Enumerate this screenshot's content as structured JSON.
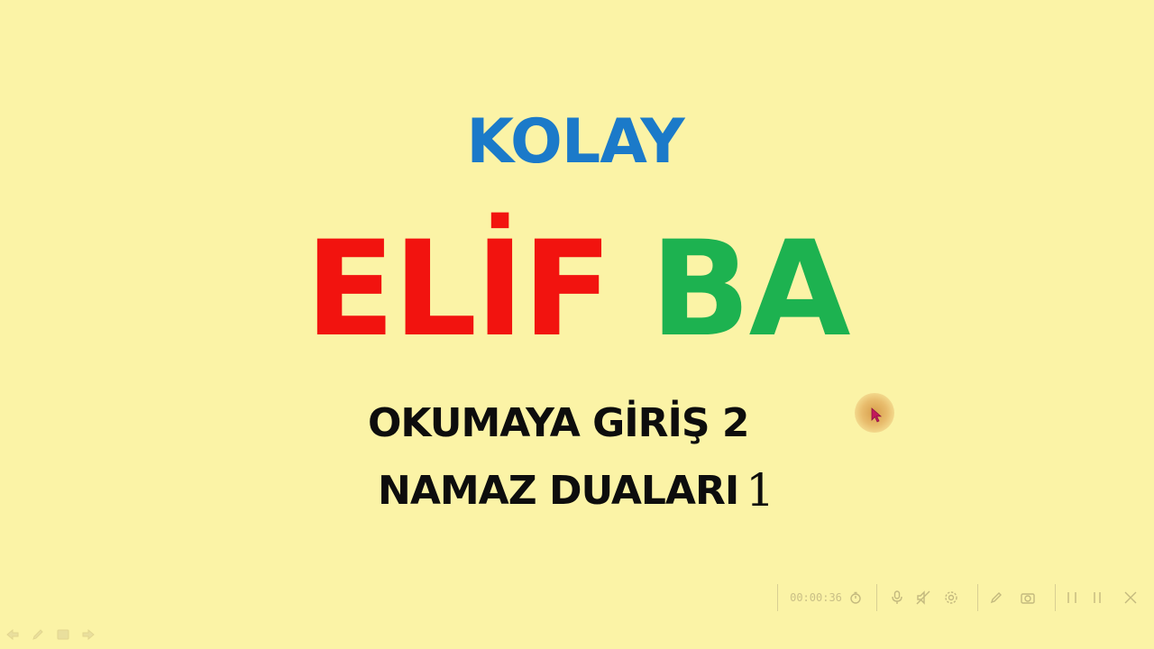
{
  "slide": {
    "line1": "KOLAY",
    "line2_word1": "ELİF",
    "line2_word2": "BA",
    "line3": "OKUMAYA GİRİŞ 2",
    "line4_text": "NAMAZ DUALARI",
    "line4_number": "1"
  },
  "colors": {
    "background": "#fbf3a6",
    "kolay": "#1b7ac9",
    "elif": "#f2130f",
    "ba": "#1db250",
    "subtitle": "#0d0d0d"
  },
  "recording_toolbar": {
    "timer": "00:00:36",
    "icons": [
      "stopwatch-icon",
      "microphone-icon",
      "speaker-muted-icon",
      "settings-icon",
      "pen-icon",
      "camera-icon",
      "pause-icon",
      "stop-icon",
      "close-icon"
    ]
  },
  "slide_nav": {
    "icons": [
      "previous-arrow-icon",
      "pen-tool-icon",
      "slide-menu-icon",
      "next-arrow-icon"
    ]
  }
}
